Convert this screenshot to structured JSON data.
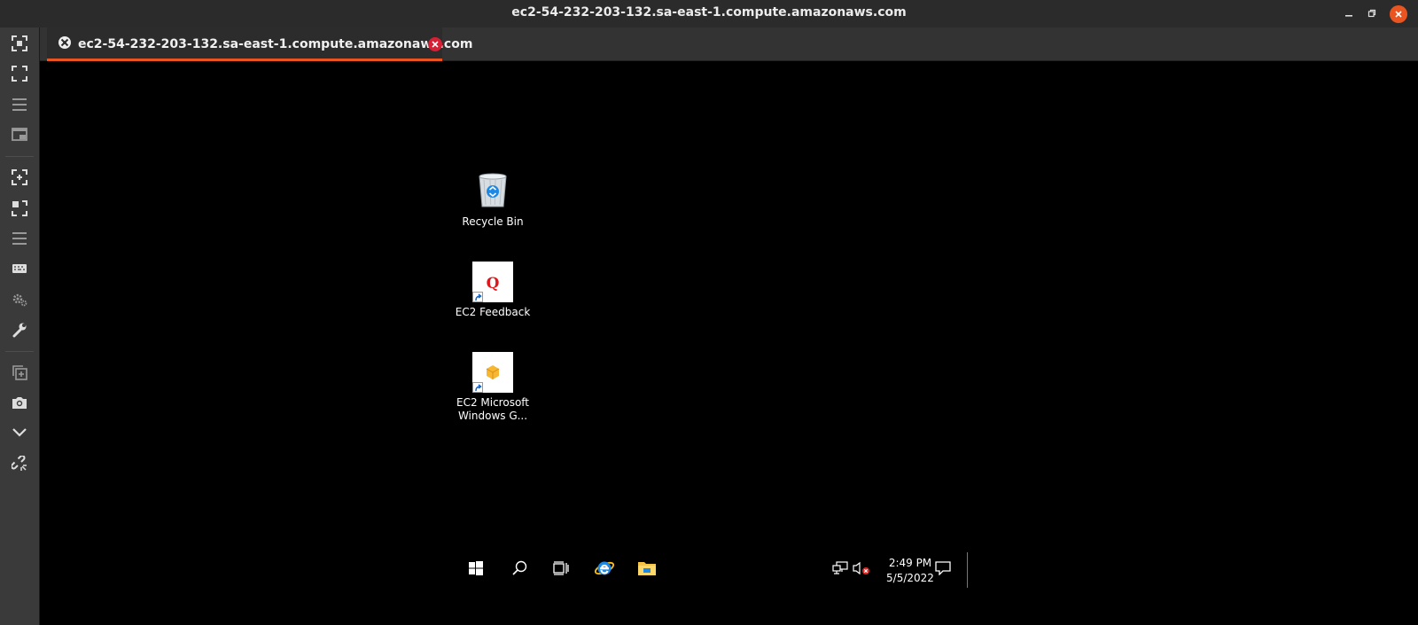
{
  "window": {
    "title": "ec2-54-232-203-132.sa-east-1.compute.amazonaws.com",
    "controls": {
      "minimize": "minimize-icon",
      "maximize": "restore-icon",
      "close": "close-icon"
    },
    "accent": "#e95420"
  },
  "tab": {
    "label": "ec2-54-232-203-132.sa-east-1.compute.amazonaws.com",
    "icon": "connection-icon",
    "close_icon": "close-icon",
    "close_color": "#d62033"
  },
  "sidebar": {
    "items": [
      {
        "icon": "fullscreen-icon"
      },
      {
        "icon": "fit-window-icon"
      },
      {
        "icon": "menu-icon"
      },
      {
        "icon": "picture-in-picture-icon"
      },
      {
        "icon": "scale-icon"
      },
      {
        "icon": "resize-icon"
      },
      {
        "icon": "list-icon"
      },
      {
        "icon": "keyboard-icon"
      },
      {
        "icon": "settings-icon"
      },
      {
        "icon": "tools-icon"
      },
      {
        "icon": "duplicate-icon"
      },
      {
        "icon": "camera-icon"
      },
      {
        "icon": "chevron-down-icon"
      },
      {
        "icon": "disconnect-icon"
      }
    ]
  },
  "desktop": {
    "icons": [
      {
        "label": "Recycle Bin",
        "icon": "recycle-bin-icon"
      },
      {
        "label": "EC2 Feedback",
        "icon": "feedback-icon"
      },
      {
        "label": "EC2 Microsoft Windows G...",
        "icon": "package-icon"
      }
    ]
  },
  "taskbar": {
    "items": [
      {
        "icon": "windows-start-icon"
      },
      {
        "icon": "search-icon"
      },
      {
        "icon": "task-view-icon"
      },
      {
        "icon": "internet-explorer-icon"
      },
      {
        "icon": "file-explorer-icon"
      }
    ],
    "tray": {
      "network_icon": "network-icon",
      "volume_icon": "volume-muted-icon",
      "time": "2:49 PM",
      "date": "5/5/2022",
      "notifications_icon": "notification-icon"
    }
  }
}
